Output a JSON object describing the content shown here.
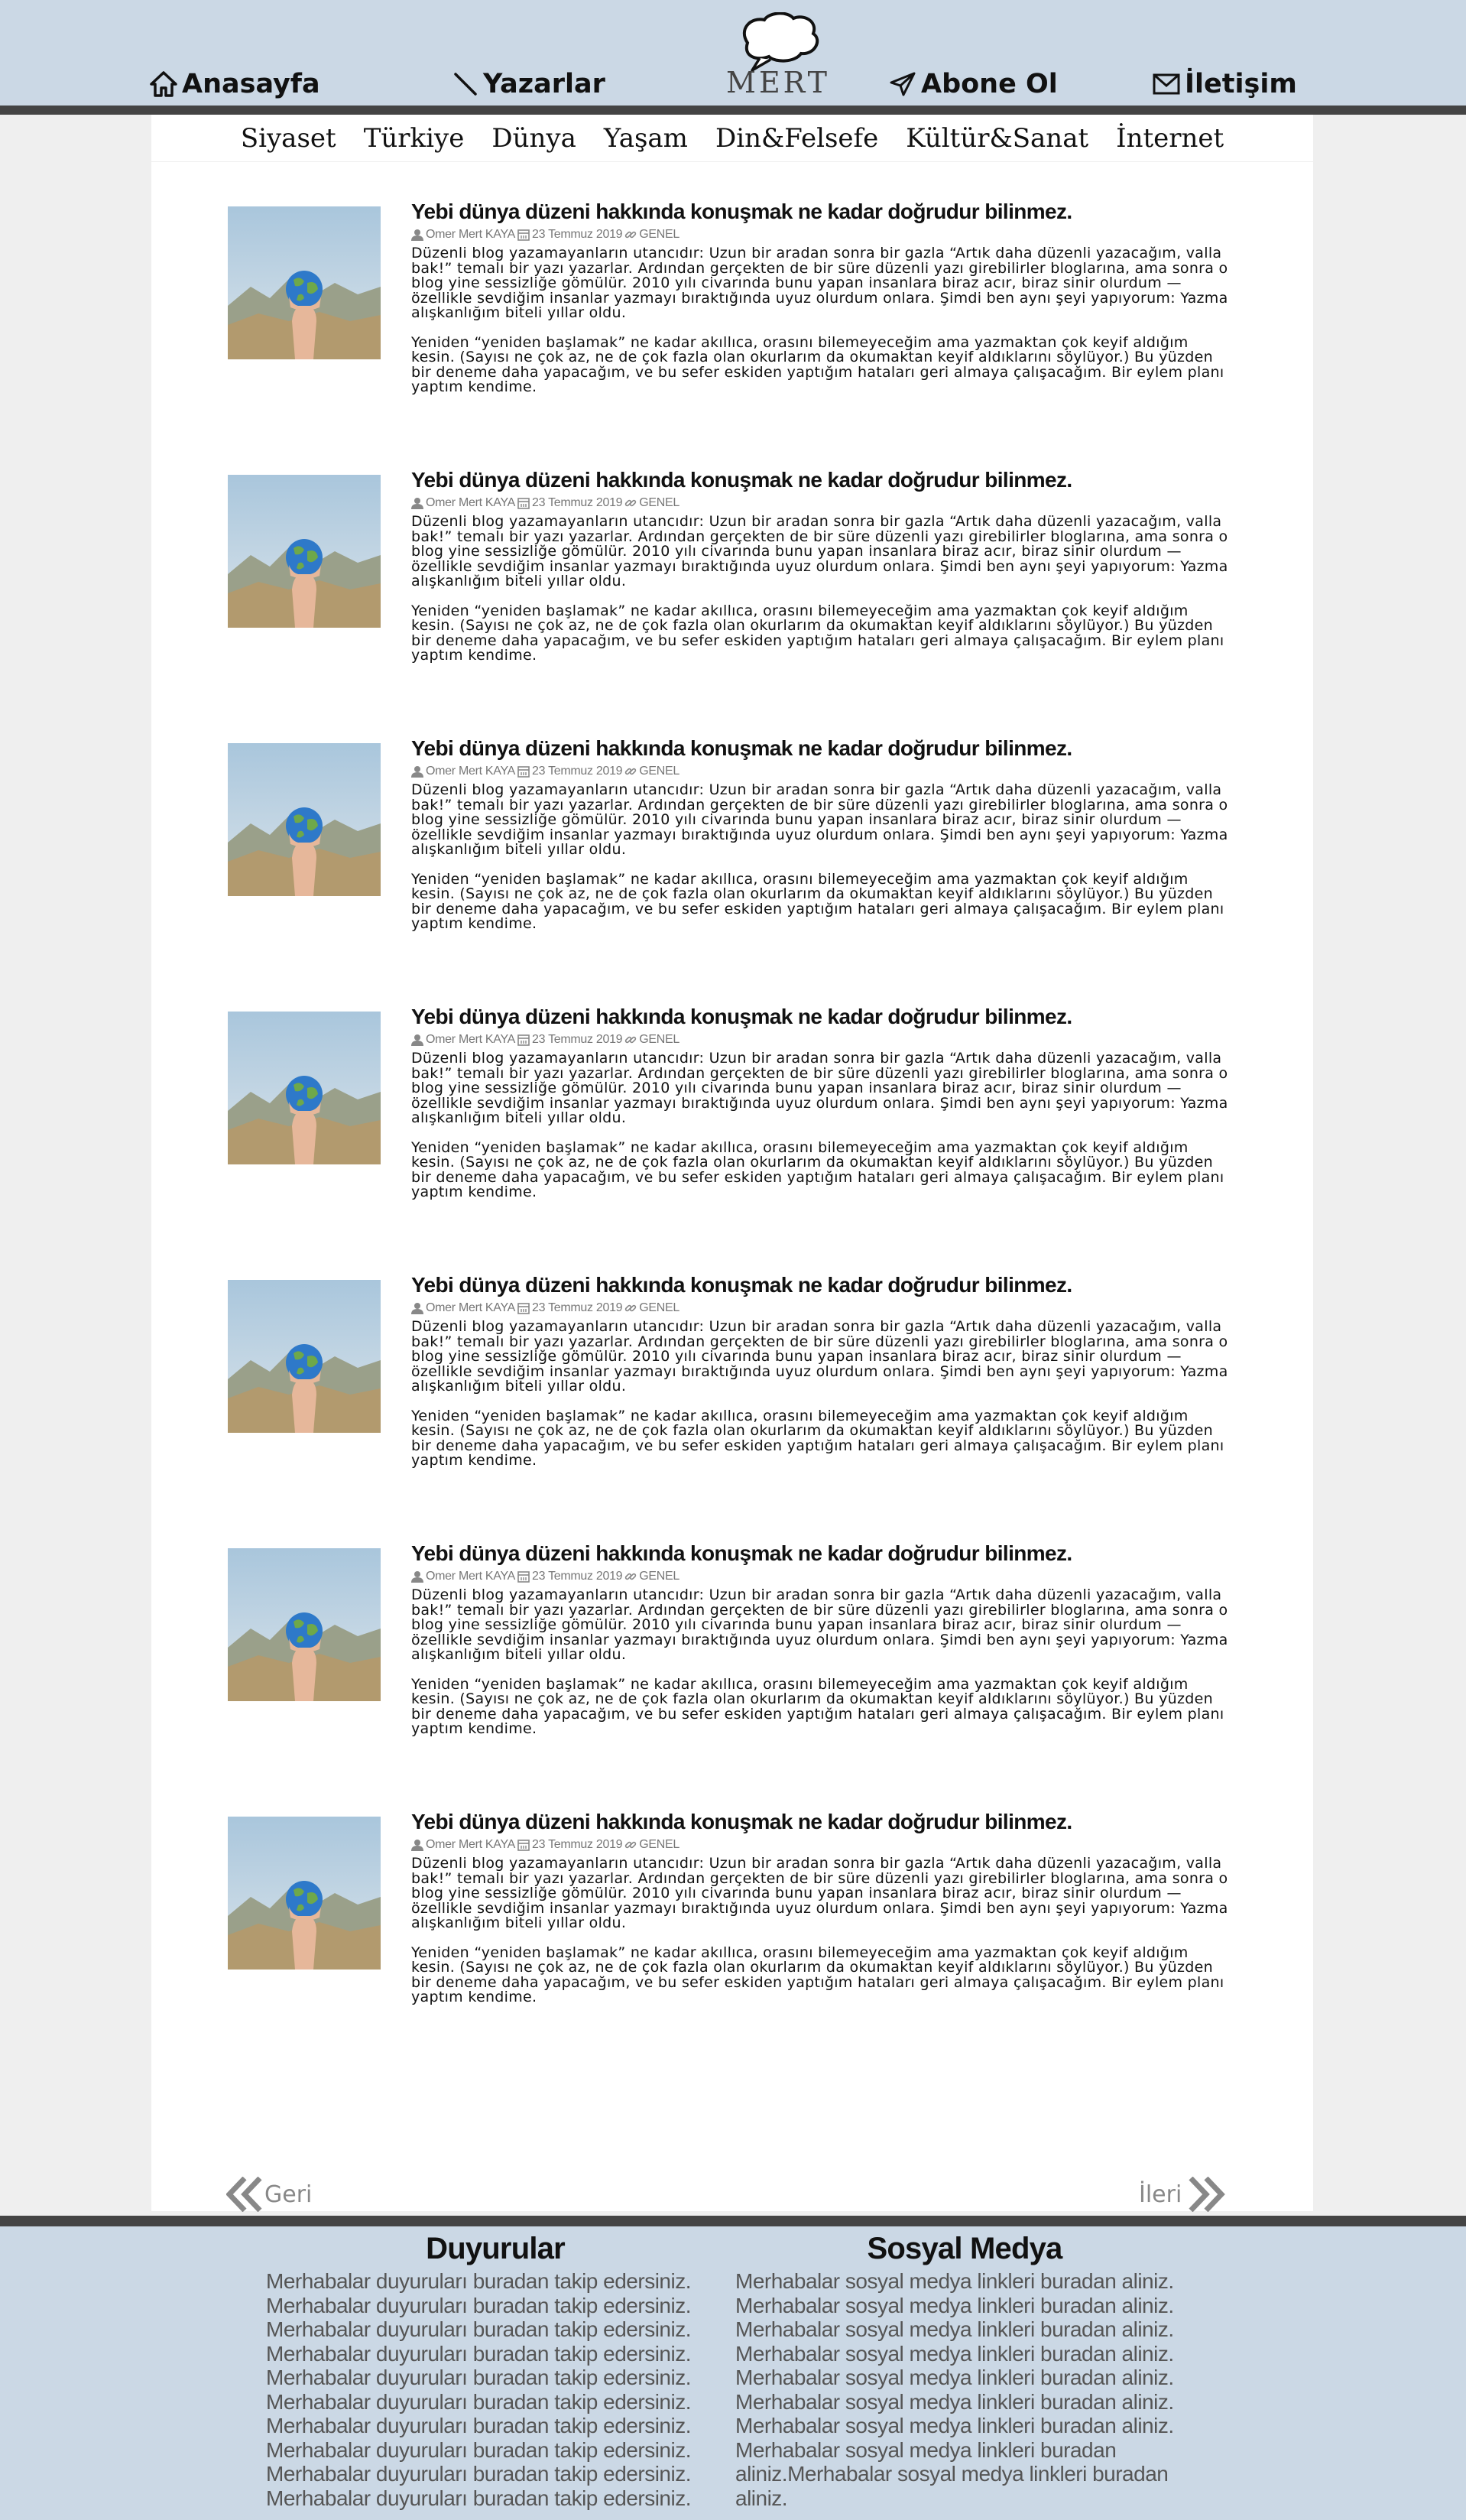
{
  "header": {
    "nav": {
      "home": "Anasayfa",
      "writers": "Yazarlar",
      "subscribe": "Abone Ol",
      "contact": "İletişim"
    },
    "logo_text": "MERT"
  },
  "categories": [
    "Siyaset",
    "Türkiye",
    "Dünya",
    "Yaşam",
    "Din&Felsefe",
    "Kültür&Sanat",
    "İnternet"
  ],
  "posts": [
    {
      "title": "Yebi dünya düzeni hakkında konuşmak ne kadar doğrudur bilinmez.",
      "author": "Omer Mert KAYA",
      "date": "23 Temmuz 2019",
      "category": "GENEL",
      "paragraph1": "Düzenli blog yazamayanların utancıdır: Uzun bir aradan sonra bir gazla “Artık daha düzenli yazacağım, valla bak!” temalı bir yazı yazarlar. Ardından gerçekten de bir süre düzenli yazı girebilirler bloglarına, ama sonra o blog yine sessizliğe gömülür. 2010 yılı civarında bunu yapan insanlara biraz acır, biraz sinir olurdum — özellikle sevdiğim insanlar yazmayı bıraktığında uyuz olurdum onlara. Şimdi ben aynı şeyi yapıyorum: Yazma alışkanlığım biteli yıllar oldu.",
      "paragraph2": "Yeniden “yeniden başlamak” ne kadar akıllıca, orasını bilemeyeceğim ama yazmaktan çok keyif aldığım kesin. (Sayısı ne çok az, ne de çok fazla olan okurlarım da okumaktan keyif aldıklarını söylüyor.) Bu yüzden bir deneme daha yapacağım, ve bu sefer eskiden yaptığım hataları geri almaya çalışacağım. Bir eylem planı yaptım kendime."
    },
    {
      "title": "Yebi dünya düzeni hakkında konuşmak ne kadar doğrudur bilinmez.",
      "author": "Omer Mert KAYA",
      "date": "23 Temmuz 2019",
      "category": "GENEL",
      "paragraph1": "Düzenli blog yazamayanların utancıdır: Uzun bir aradan sonra bir gazla “Artık daha düzenli yazacağım, valla bak!” temalı bir yazı yazarlar. Ardından gerçekten de bir süre düzenli yazı girebilirler bloglarına, ama sonra o blog yine sessizliğe gömülür. 2010 yılı civarında bunu yapan insanlara biraz acır, biraz sinir olurdum — özellikle sevdiğim insanlar yazmayı bıraktığında uyuz olurdum onlara. Şimdi ben aynı şeyi yapıyorum: Yazma alışkanlığım biteli yıllar oldu.",
      "paragraph2": "Yeniden “yeniden başlamak” ne kadar akıllıca, orasını bilemeyeceğim ama yazmaktan çok keyif aldığım kesin. (Sayısı ne çok az, ne de çok fazla olan okurlarım da okumaktan keyif aldıklarını söylüyor.) Bu yüzden bir deneme daha yapacağım, ve bu sefer eskiden yaptığım hataları geri almaya çalışacağım. Bir eylem planı yaptım kendime."
    },
    {
      "title": "Yebi dünya düzeni hakkında konuşmak ne kadar doğrudur bilinmez.",
      "author": "Omer Mert KAYA",
      "date": "23 Temmuz 2019",
      "category": "GENEL",
      "paragraph1": "Düzenli blog yazamayanların utancıdır: Uzun bir aradan sonra bir gazla “Artık daha düzenli yazacağım, valla bak!” temalı bir yazı yazarlar. Ardından gerçekten de bir süre düzenli yazı girebilirler bloglarına, ama sonra o blog yine sessizliğe gömülür. 2010 yılı civarında bunu yapan insanlara biraz acır, biraz sinir olurdum — özellikle sevdiğim insanlar yazmayı bıraktığında uyuz olurdum onlara. Şimdi ben aynı şeyi yapıyorum: Yazma alışkanlığım biteli yıllar oldu.",
      "paragraph2": "Yeniden “yeniden başlamak” ne kadar akıllıca, orasını bilemeyeceğim ama yazmaktan çok keyif aldığım kesin. (Sayısı ne çok az, ne de çok fazla olan okurlarım da okumaktan keyif aldıklarını söylüyor.) Bu yüzden bir deneme daha yapacağım, ve bu sefer eskiden yaptığım hataları geri almaya çalışacağım. Bir eylem planı yaptım kendime."
    },
    {
      "title": "Yebi dünya düzeni hakkında konuşmak ne kadar doğrudur bilinmez.",
      "author": "Omer Mert KAYA",
      "date": "23 Temmuz 2019",
      "category": "GENEL",
      "paragraph1": "Düzenli blog yazamayanların utancıdır: Uzun bir aradan sonra bir gazla “Artık daha düzenli yazacağım, valla bak!” temalı bir yazı yazarlar. Ardından gerçekten de bir süre düzenli yazı girebilirler bloglarına, ama sonra o blog yine sessizliğe gömülür. 2010 yılı civarında bunu yapan insanlara biraz acır, biraz sinir olurdum — özellikle sevdiğim insanlar yazmayı bıraktığında uyuz olurdum onlara. Şimdi ben aynı şeyi yapıyorum: Yazma alışkanlığım biteli yıllar oldu.",
      "paragraph2": "Yeniden “yeniden başlamak” ne kadar akıllıca, orasını bilemeyeceğim ama yazmaktan çok keyif aldığım kesin. (Sayısı ne çok az, ne de çok fazla olan okurlarım da okumaktan keyif aldıklarını söylüyor.) Bu yüzden bir deneme daha yapacağım, ve bu sefer eskiden yaptığım hataları geri almaya çalışacağım. Bir eylem planı yaptım kendime."
    },
    {
      "title": "Yebi dünya düzeni hakkında konuşmak ne kadar doğrudur bilinmez.",
      "author": "Omer Mert KAYA",
      "date": "23 Temmuz 2019",
      "category": "GENEL",
      "paragraph1": "Düzenli blog yazamayanların utancıdır: Uzun bir aradan sonra bir gazla “Artık daha düzenli yazacağım, valla bak!” temalı bir yazı yazarlar. Ardından gerçekten de bir süre düzenli yazı girebilirler bloglarına, ama sonra o blog yine sessizliğe gömülür. 2010 yılı civarında bunu yapan insanlara biraz acır, biraz sinir olurdum — özellikle sevdiğim insanlar yazmayı bıraktığında uyuz olurdum onlara. Şimdi ben aynı şeyi yapıyorum: Yazma alışkanlığım biteli yıllar oldu.",
      "paragraph2": "Yeniden “yeniden başlamak” ne kadar akıllıca, orasını bilemeyeceğim ama yazmaktan çok keyif aldığım kesin. (Sayısı ne çok az, ne de çok fazla olan okurlarım da okumaktan keyif aldıklarını söylüyor.) Bu yüzden bir deneme daha yapacağım, ve bu sefer eskiden yaptığım hataları geri almaya çalışacağım. Bir eylem planı yaptım kendime."
    },
    {
      "title": "Yebi dünya düzeni hakkında konuşmak ne kadar doğrudur bilinmez.",
      "author": "Omer Mert KAYA",
      "date": "23 Temmuz 2019",
      "category": "GENEL",
      "paragraph1": "Düzenli blog yazamayanların utancıdır: Uzun bir aradan sonra bir gazla “Artık daha düzenli yazacağım, valla bak!” temalı bir yazı yazarlar. Ardından gerçekten de bir süre düzenli yazı girebilirler bloglarına, ama sonra o blog yine sessizliğe gömülür. 2010 yılı civarında bunu yapan insanlara biraz acır, biraz sinir olurdum — özellikle sevdiğim insanlar yazmayı bıraktığında uyuz olurdum onlara. Şimdi ben aynı şeyi yapıyorum: Yazma alışkanlığım biteli yıllar oldu.",
      "paragraph2": "Yeniden “yeniden başlamak” ne kadar akıllıca, orasını bilemeyeceğim ama yazmaktan çok keyif aldığım kesin. (Sayısı ne çok az, ne de çok fazla olan okurlarım da okumaktan keyif aldıklarını söylüyor.) Bu yüzden bir deneme daha yapacağım, ve bu sefer eskiden yaptığım hataları geri almaya çalışacağım. Bir eylem planı yaptım kendime."
    },
    {
      "title": "Yebi dünya düzeni hakkında konuşmak ne kadar doğrudur bilinmez.",
      "author": "Omer Mert KAYA",
      "date": "23 Temmuz 2019",
      "category": "GENEL",
      "paragraph1": "Düzenli blog yazamayanların utancıdır: Uzun bir aradan sonra bir gazla “Artık daha düzenli yazacağım, valla bak!” temalı bir yazı yazarlar. Ardından gerçekten de bir süre düzenli yazı girebilirler bloglarına, ama sonra o blog yine sessizliğe gömülür. 2010 yılı civarında bunu yapan insanlara biraz acır, biraz sinir olurdum — özellikle sevdiğim insanlar yazmayı bıraktığında uyuz olurdum onlara. Şimdi ben aynı şeyi yapıyorum: Yazma alışkanlığım biteli yıllar oldu.",
      "paragraph2": "Yeniden “yeniden başlamak” ne kadar akıllıca, orasını bilemeyeceğim ama yazmaktan çok keyif aldığım kesin. (Sayısı ne çok az, ne de çok fazla olan okurlarım da okumaktan keyif aldıklarını söylüyor.) Bu yüzden bir deneme daha yapacağım, ve bu sefer eskiden yaptığım hataları geri almaya çalışacağım. Bir eylem planı yaptım kendime."
    }
  ],
  "pager": {
    "prev": "Geri",
    "next": "İleri"
  },
  "footer": {
    "announcements": {
      "title": "Duyurular",
      "items": [
        "Merhabalar duyuruları buradan takip edersiniz.",
        "Merhabalar duyuruları buradan takip edersiniz.",
        "Merhabalar duyuruları buradan takip edersiniz.",
        "Merhabalar duyuruları buradan takip edersiniz.",
        "Merhabalar duyuruları buradan takip edersiniz.",
        "Merhabalar duyuruları buradan takip edersiniz.",
        "Merhabalar duyuruları buradan takip edersiniz.",
        "Merhabalar duyuruları buradan takip edersiniz.",
        "Merhabalar duyuruları buradan takip edersiniz.",
        "Merhabalar duyuruları buradan takip edersiniz."
      ]
    },
    "social": {
      "title": "Sosyal Medya",
      "items": [
        "Merhabalar sosyal medya linkleri buradan aliniz.",
        "Merhabalar sosyal medya linkleri buradan aliniz.",
        "Merhabalar sosyal medya linkleri buradan aliniz.",
        "Merhabalar sosyal medya linkleri buradan aliniz.",
        "Merhabalar sosyal medya linkleri buradan aliniz.",
        "Merhabalar sosyal medya linkleri buradan aliniz.",
        "Merhabalar sosyal medya linkleri buradan aliniz.",
        "Merhabalar sosyal medya linkleri buradan aliniz.Merhabalar sosyal medya linkleri buradan aliniz."
      ]
    }
  },
  "icons": {
    "home": "home-icon",
    "writers": "pen-icon",
    "subscribe": "paper-plane-icon",
    "contact": "envelope-icon",
    "logo": "speech-bubble-icon",
    "author": "user-icon",
    "date": "calendar-icon",
    "category": "link-icon",
    "prev": "double-chevron-left-icon",
    "next": "double-chevron-right-icon"
  },
  "colors": {
    "header_bg": "#cbd8e5",
    "bar": "#444444",
    "page_bg": "#efefef",
    "panel_bg": "#ffffff",
    "meta_text": "#777777",
    "pager_text": "#888888"
  }
}
